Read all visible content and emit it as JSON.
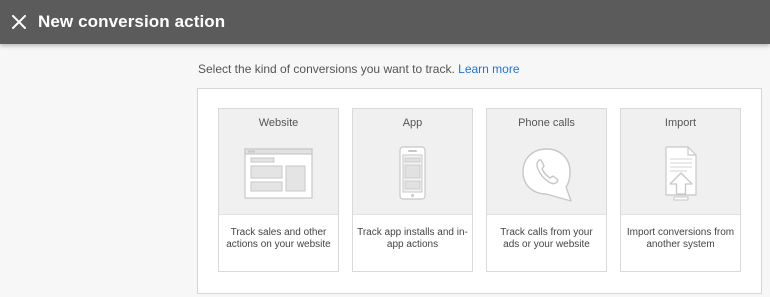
{
  "header": {
    "title": "New conversion action",
    "close_icon": "close-icon"
  },
  "intro": {
    "text": "Select the kind of conversions you want to track.",
    "link_label": "Learn more"
  },
  "options": [
    {
      "title": "Website",
      "description": "Track sales and other actions on your website",
      "icon": "website-icon"
    },
    {
      "title": "App",
      "description": "Track app installs and in-app actions",
      "icon": "mobile-app-icon"
    },
    {
      "title": "Phone calls",
      "description": "Track calls from your ads or your website",
      "icon": "phone-call-icon"
    },
    {
      "title": "Import",
      "description": "Import conversions from another system",
      "icon": "import-upload-icon"
    }
  ],
  "colors": {
    "header_bg": "#5b5b5b",
    "link": "#1a73e8",
    "card_top": "#f0f0f0",
    "icon_stroke": "#c7c7c7"
  }
}
